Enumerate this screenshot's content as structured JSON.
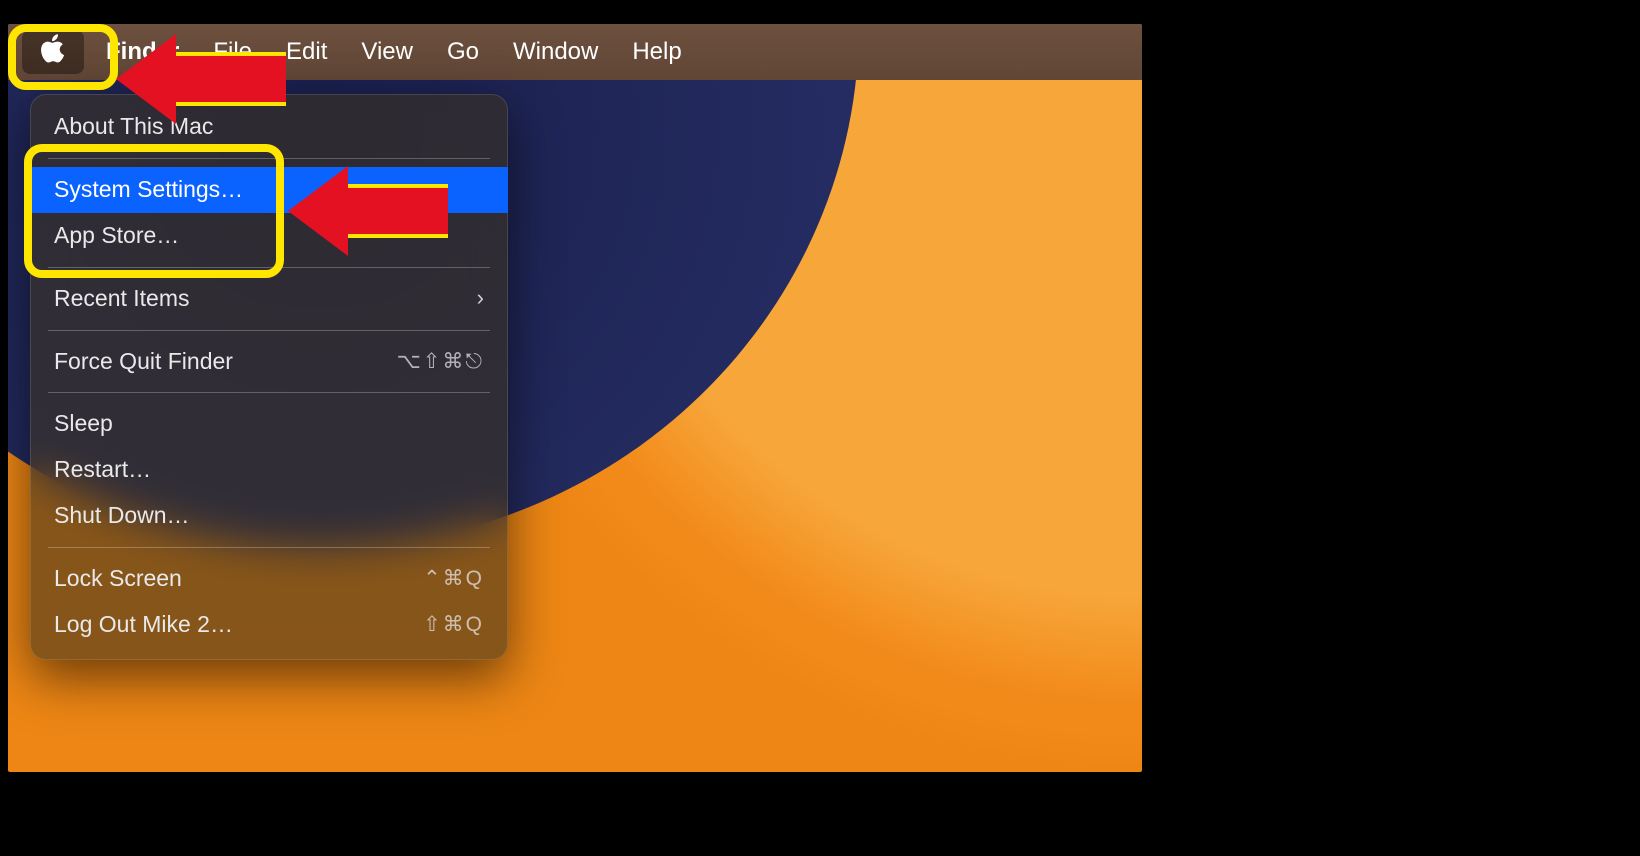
{
  "menubar": {
    "app_name": "Finder",
    "items": [
      "File",
      "Edit",
      "View",
      "Go",
      "Window",
      "Help"
    ]
  },
  "apple_menu": {
    "about": "About This Mac",
    "system_settings": "System Settings…",
    "app_store": "App Store…",
    "recent_items": "Recent Items",
    "force_quit": "Force Quit Finder",
    "force_quit_shortcut": "⌥⇧⌘⎋",
    "sleep": "Sleep",
    "restart": "Restart…",
    "shutdown": "Shut Down…",
    "lock_screen": "Lock Screen",
    "lock_screen_shortcut": "⌃⌘Q",
    "log_out": "Log Out Mike 2…",
    "log_out_shortcut": "⇧⌘Q"
  },
  "icons": {
    "chevron_right": "›"
  }
}
